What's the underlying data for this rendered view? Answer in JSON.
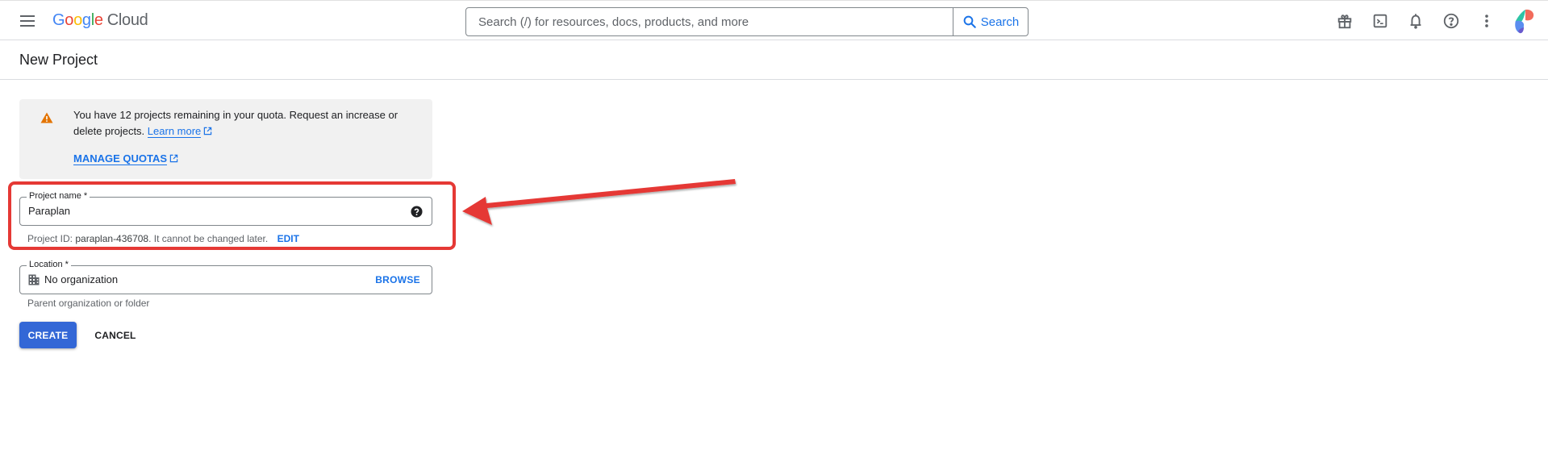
{
  "header": {
    "brand_letters": [
      "G",
      "o",
      "o",
      "g",
      "l",
      "e"
    ],
    "brand_product": "Cloud",
    "search": {
      "placeholder": "Search (/) for resources, docs, products, and more",
      "button_label": "Search"
    },
    "icons": [
      "gift-icon",
      "cloud-shell-icon",
      "notifications-icon",
      "help-icon",
      "more-vert-icon",
      "account-avatar"
    ]
  },
  "page": {
    "title": "New Project"
  },
  "quota_notice": {
    "text": "You have 12 projects remaining in your quota. Request an increase or delete projects.",
    "learn_more_label": "Learn more",
    "manage_quotas_label": "MANAGE QUOTAS"
  },
  "form": {
    "project_name": {
      "label": "Project name *",
      "value": "Paraplan"
    },
    "project_id": {
      "prefix": "Project ID: ",
      "id": "paraplan-436708",
      "suffix": ". It cannot be changed later.",
      "edit_label": "EDIT"
    },
    "location": {
      "label": "Location *",
      "value": "No organization",
      "browse_label": "BROWSE",
      "hint": "Parent organization or folder"
    },
    "create_label": "CREATE",
    "cancel_label": "CANCEL"
  },
  "annotation": {
    "highlight_color": "#e53935",
    "arrow_color": "#e53935"
  },
  "colors": {
    "accent": "#1a73e8",
    "primary_button": "#3367d6",
    "warning": "#e37400"
  }
}
